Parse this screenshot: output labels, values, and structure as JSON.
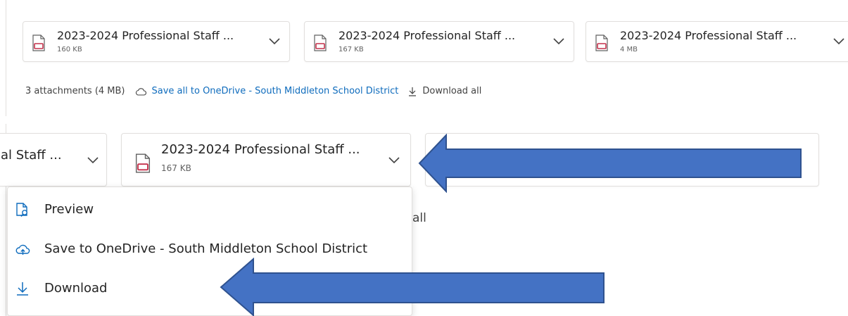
{
  "attachments": [
    {
      "name": "2023-2024 Professional Staff ...",
      "size": "160 KB"
    },
    {
      "name": "2023-2024 Professional Staff ...",
      "size": "167 KB"
    },
    {
      "name": "2023-2024 Professional Staff ...",
      "size": "4 MB"
    }
  ],
  "bar": {
    "summary": "3 attachments (4 MB)",
    "save_all": "Save all to OneDrive - South Middleton School District",
    "download_all": "Download all"
  },
  "zoomed": {
    "partial_chip_name": "al Staff ...",
    "selected_chip": {
      "name": "2023-2024 Professional Staff ...",
      "size": "167 KB"
    },
    "partial_bar_text": "all"
  },
  "menu": {
    "items": [
      {
        "label": "Preview",
        "icon": "preview-icon"
      },
      {
        "label": "Save to OneDrive - South Middleton School District",
        "icon": "cloud-upload-icon"
      },
      {
        "label": "Download",
        "icon": "download-icon"
      }
    ]
  },
  "colors": {
    "accent": "#0f6cbd",
    "pdf": "#c4314b",
    "annotation_arrow": "#4472c4",
    "annotation_arrow_border": "#2f528f"
  }
}
